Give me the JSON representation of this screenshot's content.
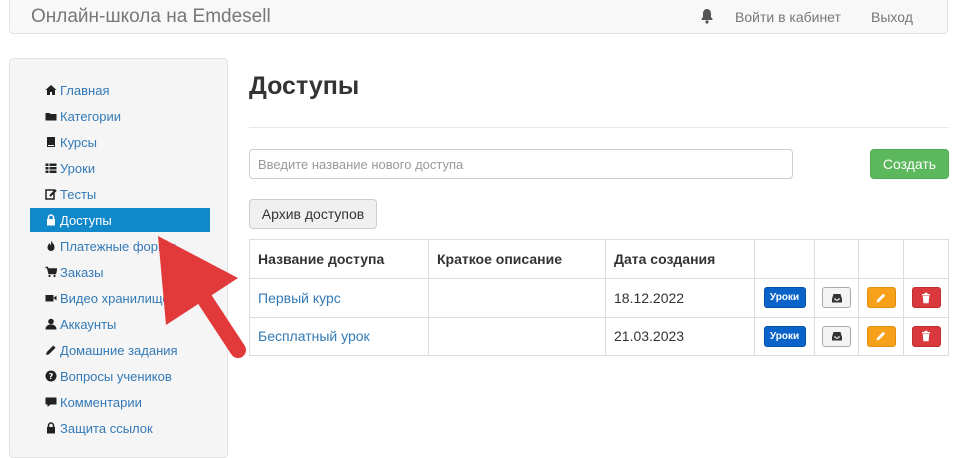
{
  "navbar": {
    "brand": "Онлайн-школа на Emdesell",
    "bell_icon": "bell-icon",
    "login": "Войти в кабинет",
    "logout": "Выход"
  },
  "sidebar": {
    "items": [
      {
        "label": "Главная",
        "icon": "home-icon"
      },
      {
        "label": "Категории",
        "icon": "folder-icon"
      },
      {
        "label": "Курсы",
        "icon": "book-icon"
      },
      {
        "label": "Уроки",
        "icon": "list-icon"
      },
      {
        "label": "Тесты",
        "icon": "edit-icon"
      },
      {
        "label": "Доступы",
        "icon": "lock-icon",
        "active": true
      },
      {
        "label": "Платежные формы",
        "icon": "fire-icon"
      },
      {
        "label": "Заказы",
        "icon": "cart-icon"
      },
      {
        "label": "Видео хранилище",
        "icon": "video-icon"
      },
      {
        "label": "Аккаунты",
        "icon": "user-icon"
      },
      {
        "label": "Домашние задания",
        "icon": "pencil-icon"
      },
      {
        "label": "Вопросы учеников",
        "icon": "question-icon"
      },
      {
        "label": "Комментарии",
        "icon": "comment-icon"
      },
      {
        "label": "Защита ссылок",
        "icon": "lock-icon"
      }
    ]
  },
  "main": {
    "title": "Доступы",
    "new_access_placeholder": "Введите название нового доступа",
    "create_label": "Создать",
    "archive_label": "Архив доступов"
  },
  "table": {
    "headers": [
      "Название доступа",
      "Краткое описание",
      "Дата создания"
    ],
    "rows": [
      {
        "name": "Первый курс",
        "description": "",
        "date": "18.12.2022"
      },
      {
        "name": "Бесплатный урок",
        "description": "",
        "date": "21.03.2023"
      }
    ],
    "lessons_label": "Уроки"
  },
  "colors": {
    "active_sidebar": "#1188c9",
    "create_button": "#5cb85c",
    "lessons_button": "#0a63c9",
    "edit_button": "#f7a11a",
    "delete_button": "#d9393c",
    "arrow": "#e23a3a"
  }
}
